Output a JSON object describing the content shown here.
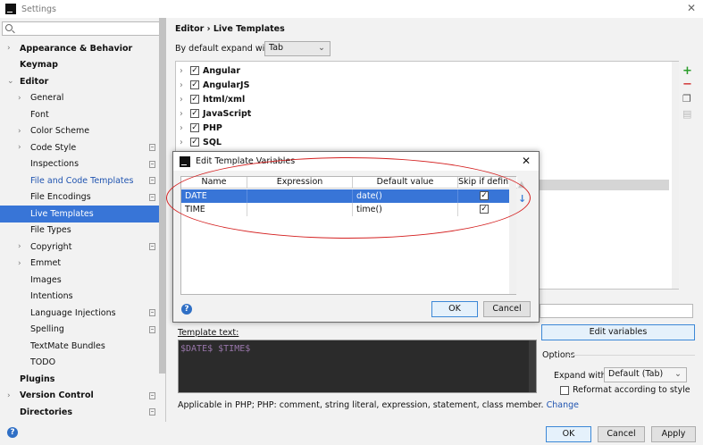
{
  "window": {
    "title": "Settings"
  },
  "search": {
    "placeholder": ""
  },
  "sidebar": {
    "items": [
      {
        "label": "Appearance & Behavior"
      },
      {
        "label": "Keymap"
      },
      {
        "label": "Editor"
      },
      {
        "label": "General"
      },
      {
        "label": "Font"
      },
      {
        "label": "Color Scheme"
      },
      {
        "label": "Code Style"
      },
      {
        "label": "Inspections"
      },
      {
        "label": "File and Code Templates"
      },
      {
        "label": "File Encodings"
      },
      {
        "label": "Live Templates"
      },
      {
        "label": "File Types"
      },
      {
        "label": "Copyright"
      },
      {
        "label": "Emmet"
      },
      {
        "label": "Images"
      },
      {
        "label": "Intentions"
      },
      {
        "label": "Language Injections"
      },
      {
        "label": "Spelling"
      },
      {
        "label": "TextMate Bundles"
      },
      {
        "label": "TODO"
      },
      {
        "label": "Plugins"
      },
      {
        "label": "Version Control"
      },
      {
        "label": "Directories"
      }
    ]
  },
  "main": {
    "breadcrumb": "Editor › Live Templates",
    "expand_label": "By default expand with",
    "expand_value": "Tab",
    "template_groups": [
      "Angular",
      "AngularJS",
      "html/xml",
      "JavaScript",
      "PHP",
      "SQL"
    ],
    "template_text_label": "Template text:",
    "template_text": "$DATE$ $TIME$",
    "edit_variables_label": "Edit variables",
    "options_label": "Options",
    "expand_with_label": "Expand with",
    "expand_with_value": "Default (Tab)",
    "reformat_label": "Reformat according to style",
    "applicable_text": "Applicable in PHP; PHP: comment, string literal, expression, statement, class member.",
    "change_link": "Change"
  },
  "dialog": {
    "title": "Edit Template Variables",
    "columns": [
      "Name",
      "Expression",
      "Default value",
      "Skip if defin..."
    ],
    "rows": [
      {
        "name": "DATE",
        "expression": "",
        "default_value": "date()",
        "skip": "✓"
      },
      {
        "name": "TIME",
        "expression": "",
        "default_value": "time()",
        "skip": "✓"
      }
    ],
    "ok_label": "OK",
    "cancel_label": "Cancel"
  },
  "footer": {
    "ok_label": "OK",
    "cancel_label": "Cancel",
    "apply_label": "Apply"
  },
  "annotation_color": "#d42020",
  "accent_color": "#3875d7"
}
